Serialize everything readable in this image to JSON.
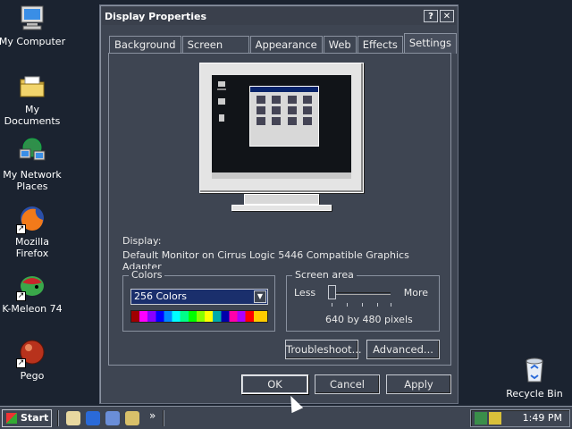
{
  "desktop": {
    "icons": [
      {
        "label": "My Computer",
        "icon": "my-computer-icon"
      },
      {
        "label": "My Documents",
        "icon": "folder-icon"
      },
      {
        "label": "My Network Places",
        "icon": "network-icon"
      },
      {
        "label": "Mozilla Firefox",
        "icon": "firefox-icon"
      },
      {
        "label": "K-Meleon 74",
        "icon": "k-meleon-icon"
      },
      {
        "label": "Pego",
        "icon": "pego-icon"
      }
    ],
    "recycle_bin": {
      "label": "Recycle Bin",
      "icon": "recycle-bin-icon"
    }
  },
  "window": {
    "title": "Display Properties",
    "help_label": "?",
    "close_label": "✕",
    "tabs": [
      "Background",
      "Screen Saver",
      "Appearance",
      "Web",
      "Effects",
      "Settings"
    ],
    "active_tab": "Settings",
    "display_label": "Display:",
    "display_value": "Default Monitor on Cirrus Logic 5446 Compatible Graphics Adapter",
    "colors": {
      "legend": "Colors",
      "selected": "256 Colors"
    },
    "screen_area": {
      "legend": "Screen area",
      "less_label": "Less",
      "more_label": "More",
      "resolution": "640 by 480 pixels",
      "slider_level": 0
    },
    "buttons": {
      "troubleshoot": "Troubleshoot...",
      "advanced": "Advanced...",
      "ok": "OK",
      "cancel": "Cancel",
      "apply": "Apply"
    }
  },
  "taskbar": {
    "start_label": "Start",
    "chevron": "»",
    "clock": "1:49 PM"
  },
  "colors": {
    "desktop_bg": "#1b2330",
    "window_bg": "#3e4552",
    "selection_bg": "#1a2f6c"
  }
}
